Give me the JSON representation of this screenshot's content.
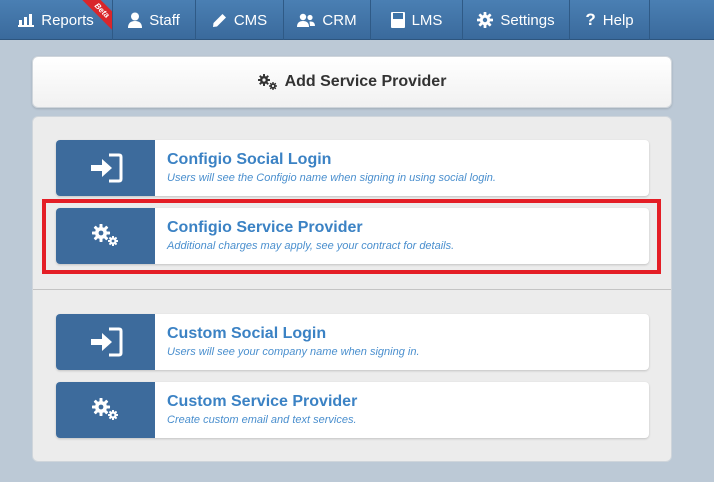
{
  "nav": {
    "items": [
      {
        "label": "Reports",
        "icon": "bar-chart-icon"
      },
      {
        "label": "Staff",
        "icon": "user-icon"
      },
      {
        "label": "CMS",
        "icon": "pencil-icon"
      },
      {
        "label": "CRM",
        "icon": "users-icon"
      },
      {
        "label": "LMS",
        "icon": "book-icon"
      },
      {
        "label": "Settings",
        "icon": "gear-icon"
      },
      {
        "label": "Help",
        "icon": "question-icon"
      }
    ],
    "beta_label": "Beta"
  },
  "header": {
    "title": "Add Service Provider",
    "icon": "gears-icon"
  },
  "options": [
    {
      "title": "Configio Social Login",
      "desc": "Users will see the Configio name when signing in using social login.",
      "icon": "sign-in-icon"
    },
    {
      "title": "Configio Service Provider",
      "desc": "Additional charges may apply, see your contract for details.",
      "icon": "gears-icon"
    },
    {
      "title": "Custom Social Login",
      "desc": "Users will see your company name when signing in.",
      "icon": "sign-in-icon"
    },
    {
      "title": "Custom Service Provider",
      "desc": "Create custom email and text services.",
      "icon": "gears-icon"
    }
  ],
  "colors": {
    "nav_bg": "#3f74a8",
    "icon_box": "#3d6b9c",
    "title_link": "#3b82c4",
    "highlight": "#e41e26",
    "beta": "#d9262b"
  }
}
